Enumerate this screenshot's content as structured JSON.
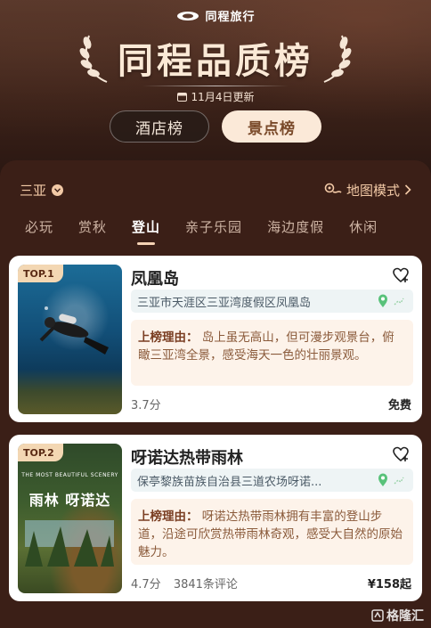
{
  "header": {
    "brand": "同程旅行",
    "title": "同程品质榜",
    "update_text": "11月4日更新",
    "tabs": [
      {
        "label": "酒店榜",
        "active": false
      },
      {
        "label": "景点榜",
        "active": true
      }
    ]
  },
  "location": {
    "city": "三亚",
    "map_mode": "地图模式"
  },
  "category_tabs": [
    "必玩",
    "赏秋",
    "登山",
    "亲子乐园",
    "海边度假",
    "休闲"
  ],
  "active_category": "登山",
  "cards": [
    {
      "rank": "TOP.1",
      "name": "凤凰岛",
      "address": "三亚市天涯区三亚湾度假区凤凰岛",
      "reason_label": "上榜理由：",
      "reason_text": "岛上虽无高山，但可漫步观景台，俯瞰三亚湾全景，感受海天一色的壮丽景观。",
      "rating": "3.7分",
      "reviews": "",
      "price": "免费"
    },
    {
      "rank": "TOP.2",
      "name": "呀诺达热带雨林",
      "address": "保亭黎族苗族自治县三道农场呀诺...",
      "reason_label": "上榜理由：",
      "reason_text": "呀诺达热带雨林拥有丰富的登山步道，沿途可欣赏热带雨林奇观，感受大自然的原始魅力。",
      "rating": "4.7分",
      "reviews": "3841条评论",
      "price": "¥158起",
      "image_caption_small": "THE MOST BEAUTIFUL SCENERY",
      "image_caption_big": "雨林 呀诺达"
    }
  ],
  "watermark": "格隆汇",
  "colors": {
    "panel_bg": "#3b1f17",
    "accent": "#f2c9a6",
    "badge": "#f3d7b3"
  }
}
